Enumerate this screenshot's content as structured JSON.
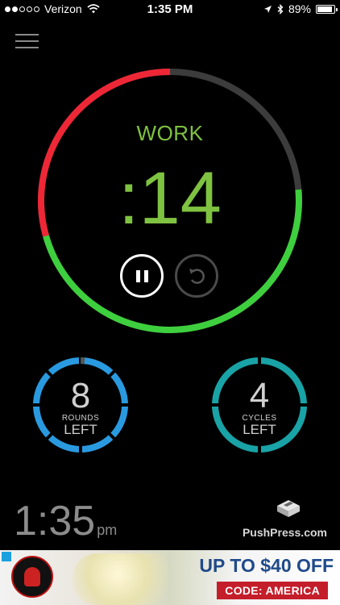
{
  "status_bar": {
    "signal_filled": 2,
    "signal_total": 5,
    "carrier": "Verizon",
    "time": "1:35 PM",
    "battery_percent": "89%",
    "battery_level": 0.89,
    "icons": [
      "wifi-icon",
      "location-arrow-icon",
      "bluetooth-icon",
      "battery-icon"
    ]
  },
  "menu": {
    "icon": "hamburger-menu-icon"
  },
  "timer": {
    "phase": "WORK",
    "countdown": ":14",
    "pause_icon": "pause-icon",
    "reset_icon": "reset-icon",
    "ring_progress_remaining": 0.47,
    "colors": {
      "work": "#7fc241",
      "elapsed": "#ee2737",
      "track": "#3c3c3c"
    }
  },
  "rounds": {
    "value": "8",
    "label_top": "ROUNDS",
    "label_bottom": "LEFT",
    "color": "#2a9ae0"
  },
  "cycles": {
    "value": "4",
    "label_top": "CYCLES",
    "label_bottom": "LEFT",
    "color": "#19a3a6"
  },
  "clock": {
    "time": "1:35",
    "ampm": "pm"
  },
  "brand": {
    "name": "PushPress.com",
    "logo_icon": "pushpress-logo-icon"
  },
  "ad": {
    "headline": "UP TO $40 OFF",
    "code": "CODE: AMERICA",
    "choices_icon": "ad-choices-icon",
    "badge_icon": "spartan-race-logo-icon"
  }
}
